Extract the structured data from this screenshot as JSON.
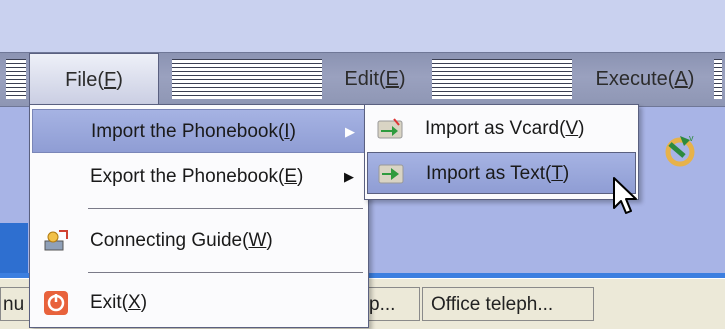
{
  "menubar": {
    "file": "File(",
    "file_key": "F",
    "edit": "Edit(",
    "edit_key": "E",
    "execute": "Execute(",
    "execute_key": "A",
    "close": ")"
  },
  "file_menu": {
    "import_label": "Import the Phonebook(",
    "import_key": "I",
    "export_label": "Export the Phonebook(",
    "export_key": "E",
    "guide_label": "Connecting Guide(",
    "guide_key": "W",
    "exit_label": "Exit(",
    "exit_key": "X",
    "close": ")",
    "icons": [
      "connecting-guide-icon",
      "exit-icon"
    ]
  },
  "import_submenu": {
    "vcard_label": "Import as Vcard(",
    "vcard_key": "V",
    "text_label": "Import as Text(",
    "text_key": "T",
    "close": ")",
    "icons": [
      "import-vcard-icon",
      "import-text-icon"
    ]
  },
  "status_bar": {
    "cell_left": "nu",
    "cell_mid": "p...",
    "cell_office": "Office teleph..."
  },
  "colors": {
    "menubar": "#9aa1bf",
    "highlight": "#a6b3e3",
    "background_blue": "#a8b4e6",
    "accent_blue": "#3c7fe0"
  }
}
